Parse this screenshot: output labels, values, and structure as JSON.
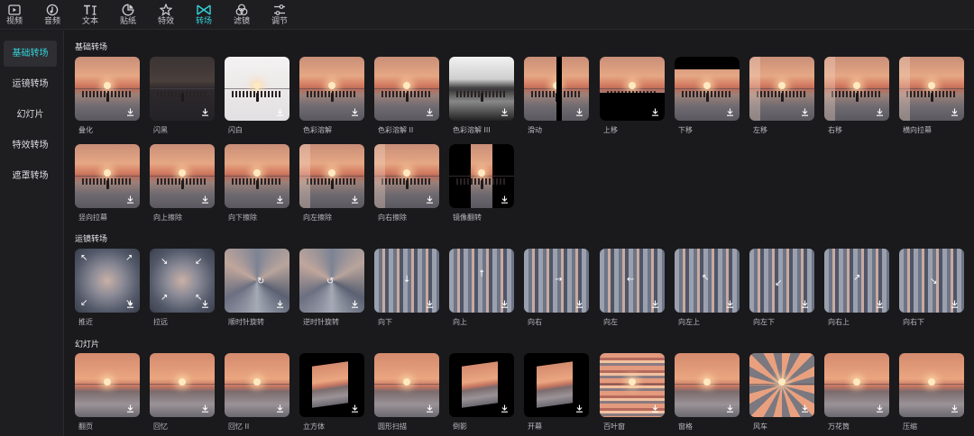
{
  "toolbar": [
    {
      "label": "视频",
      "icon": "video-icon"
    },
    {
      "label": "音频",
      "icon": "audio-icon"
    },
    {
      "label": "文本",
      "icon": "text-icon"
    },
    {
      "label": "贴纸",
      "icon": "sticker-icon"
    },
    {
      "label": "特效",
      "icon": "effects-icon"
    },
    {
      "label": "转场",
      "icon": "transition-icon",
      "active": true
    },
    {
      "label": "滤镜",
      "icon": "filter-icon"
    },
    {
      "label": "调节",
      "icon": "adjust-icon"
    }
  ],
  "sidebar": [
    {
      "label": "基础转场",
      "active": true
    },
    {
      "label": "运镜转场"
    },
    {
      "label": "幻灯片"
    },
    {
      "label": "特效转场"
    },
    {
      "label": "遮罩转场"
    }
  ],
  "sections": {
    "basic": {
      "title": "基础转场",
      "items": [
        "叠化",
        "闪黑",
        "闪白",
        "色彩溶解",
        "色彩溶解 II",
        "色彩溶解 III",
        "滑动",
        "上移",
        "下移",
        "左移",
        "右移",
        "横向拉幕",
        "竖向拉幕",
        "向上擦除",
        "向下擦除",
        "向左擦除",
        "向右擦除",
        "镜像翻转"
      ]
    },
    "camera": {
      "title": "运镜转场",
      "items": [
        "推近",
        "拉远",
        "顺时针旋转",
        "逆时针旋转",
        "向下",
        "向上",
        "向右",
        "向左",
        "向左上",
        "向左下",
        "向右上",
        "向右下"
      ]
    },
    "slides": {
      "title": "幻灯片",
      "items": [
        "翻页",
        "回忆",
        "回忆 II",
        "立方体",
        "圆形扫描",
        "倒影",
        "开幕",
        "百叶窗",
        "窗格",
        "风车",
        "万花筒",
        "压缩"
      ]
    }
  },
  "colors": {
    "accent": "#35d1d9",
    "background": "#1a1a1d",
    "panel": "#1e1e21"
  }
}
